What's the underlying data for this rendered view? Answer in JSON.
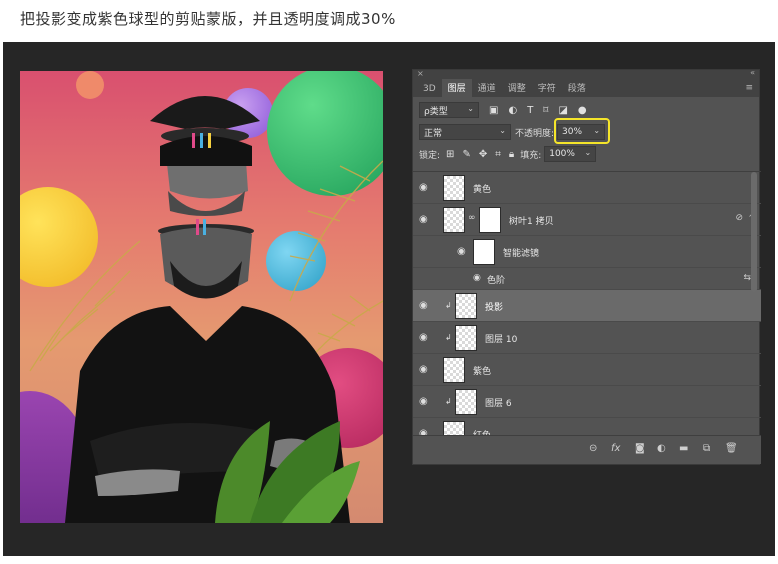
{
  "caption": "把投影变成紫色球型的剪贴蒙版，并且透明度调成30%",
  "panel": {
    "tabs": [
      "3D",
      "图层",
      "通道",
      "调整",
      "字符",
      "段落"
    ],
    "active_tab": "图层",
    "filter_kind": "ρ类型",
    "blend_mode": "正常",
    "opacity_label": "不透明度:",
    "opacity_value": "30%",
    "lock_label": "锁定:",
    "fill_label": "填充:",
    "fill_value": "100%",
    "layers": [
      {
        "name": "黄色"
      },
      {
        "name": "树叶1 拷贝"
      },
      {
        "name": "智能滤镜"
      },
      {
        "name": "色阶"
      },
      {
        "name": "投影"
      },
      {
        "name": "图层 10"
      },
      {
        "name": "紫色"
      },
      {
        "name": "图层 6"
      },
      {
        "name": "红色"
      }
    ]
  },
  "colors": {
    "highlight": "#f5e52a",
    "panel_bg": "#535353",
    "stage_bg": "#262626"
  }
}
